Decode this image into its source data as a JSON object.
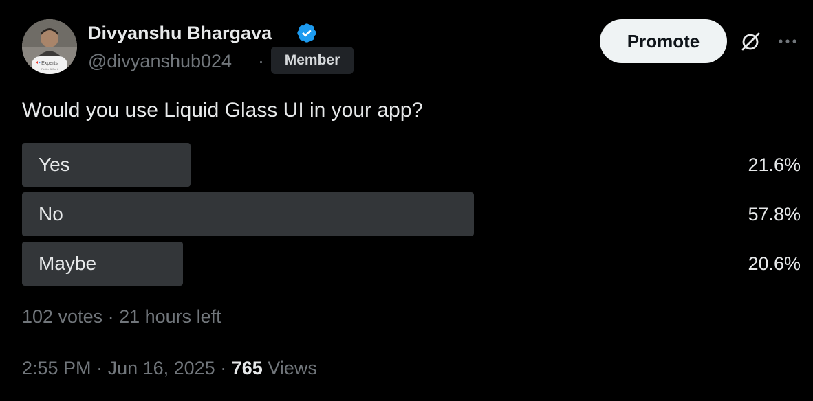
{
  "author": {
    "display_name": "Divyanshu Bhargava",
    "handle": "@divyanshub024",
    "separator": "·",
    "badge": "Member",
    "avatar_text": "Experts",
    "avatar_subtext": "Flutter & Dart",
    "verified_icon": "verified-badge-icon"
  },
  "actions": {
    "promote_label": "Promote",
    "grok_icon": "grok-icon",
    "more_icon": "more-options-icon"
  },
  "post": {
    "question": "Would you use Liquid Glass UI in your app?"
  },
  "poll": {
    "options": [
      {
        "label": "Yes",
        "percent_text": "21.6%",
        "percent": 21.6
      },
      {
        "label": "No",
        "percent_text": "57.8%",
        "percent": 57.8
      },
      {
        "label": "Maybe",
        "percent_text": "20.6%",
        "percent": 20.6
      }
    ],
    "votes": "102 votes",
    "meta_separator": " · ",
    "time_left": "21 hours left"
  },
  "footer": {
    "time": "2:55 PM",
    "separator": " · ",
    "date": "Jun 16, 2025",
    "views_count": "765",
    "views_label": "Views"
  },
  "colors": {
    "background": "#000000",
    "text_primary": "#e7e9ea",
    "text_secondary": "#71767b",
    "poll_bar": "#333639",
    "verified_blue": "#1d9bf0",
    "promote_bg": "#eff3f4"
  }
}
